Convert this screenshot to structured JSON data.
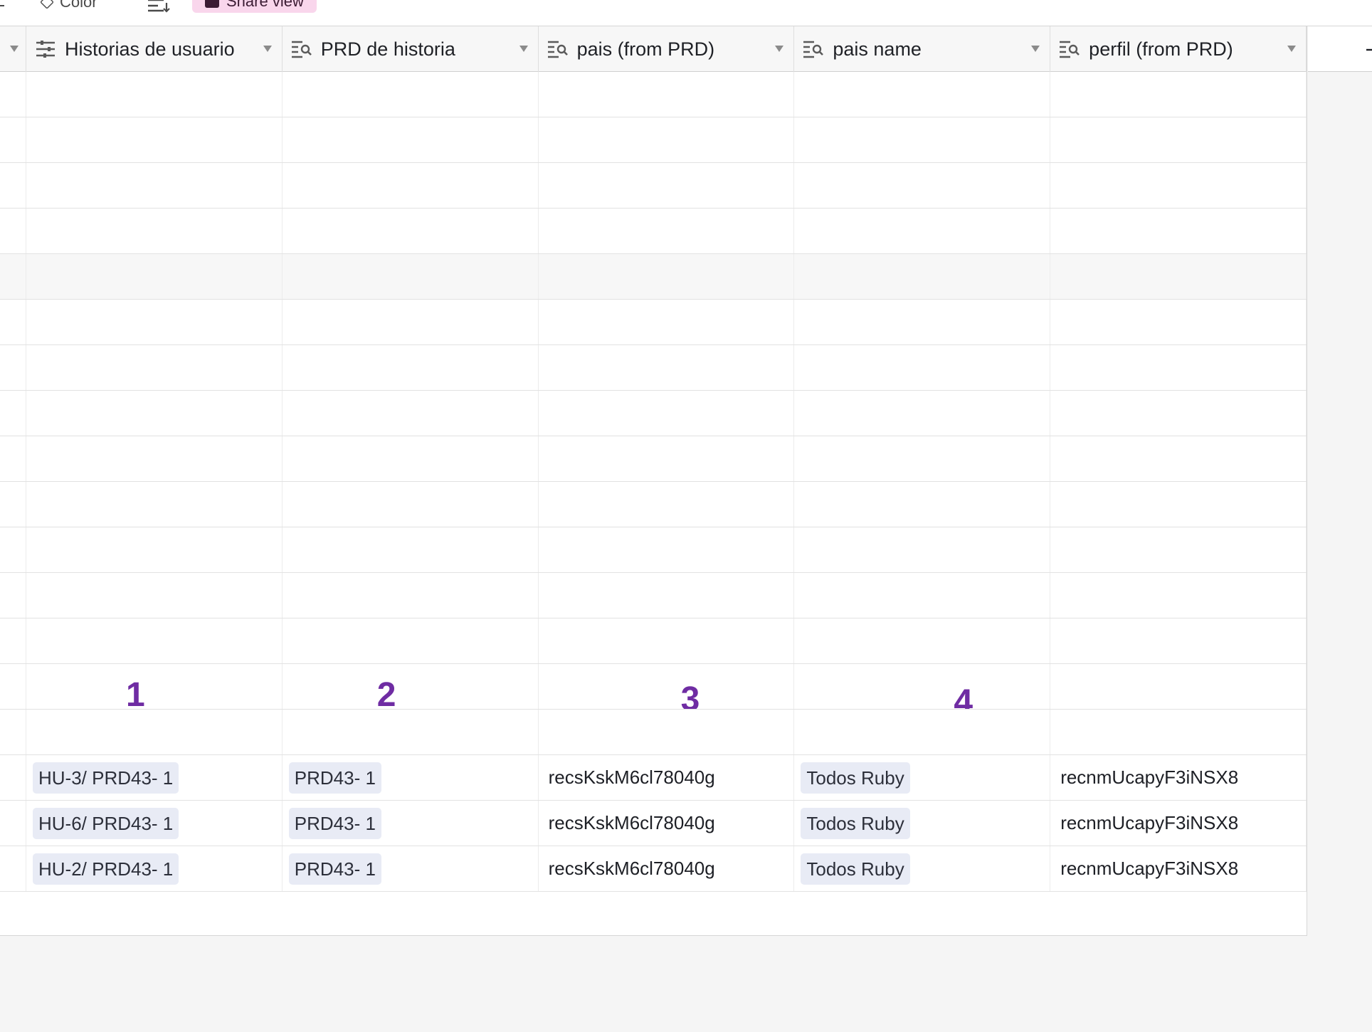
{
  "toolbar": {
    "color_label": "Color",
    "share_label": "Share view",
    "share_color": "#f9d6ec"
  },
  "columns": [
    {
      "label": "Historias de usuario",
      "icon": "long-text-icon"
    },
    {
      "label": "PRD de historia",
      "icon": "lookup-icon"
    },
    {
      "label": "pais (from PRD)",
      "icon": "lookup-icon"
    },
    {
      "label": "pais name",
      "icon": "lookup-icon"
    },
    {
      "label": "perfil (from PRD)",
      "icon": "lookup-icon"
    }
  ],
  "markers": [
    "1",
    "2",
    "3",
    "4"
  ],
  "marker_color": "#6f2ca3",
  "rows": [
    {
      "historia": "HU-3/ PRD43- 1",
      "prd": "PRD43- 1",
      "pais": "recsKskM6cl78040g",
      "pais_name": "Todos Ruby",
      "perfil": "recnmUcapyF3iNSX8"
    },
    {
      "historia": "HU-6/ PRD43- 1",
      "prd": "PRD43- 1",
      "pais": "recsKskM6cl78040g",
      "pais_name": "Todos Ruby",
      "perfil": "recnmUcapyF3iNSX8"
    },
    {
      "historia": "HU-2/ PRD43- 1",
      "prd": "PRD43- 1",
      "pais": "recsKskM6cl78040g",
      "pais_name": "Todos Ruby",
      "perfil": "recnmUcapyF3iNSX8"
    }
  ],
  "chip_color": "#e8ebf5"
}
